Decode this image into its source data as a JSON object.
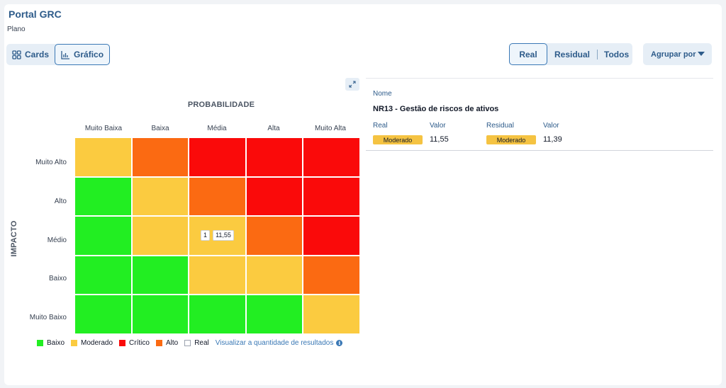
{
  "header": {
    "title": "Portal GRC",
    "subtitle": "Plano"
  },
  "view_toggle": {
    "cards": "Cards",
    "grafico": "Gráfico",
    "active": "grafico"
  },
  "mode_toggle": {
    "real": "Real",
    "residual": "Residual",
    "todos": "Todos",
    "active": "real"
  },
  "group_by": {
    "label": "Agrupar por"
  },
  "matrix": {
    "x_axis_title": "PROBABILIDADE",
    "y_axis_title": "IMPACTO",
    "columns": [
      "Muito Baixa",
      "Baixa",
      "Média",
      "Alta",
      "Muito Alta"
    ],
    "rows": [
      "Muito Alto",
      "Alto",
      "Médio",
      "Baixo",
      "Muito Baixo"
    ],
    "levels": {
      "baixo": "#22ee22",
      "moderado": "#fbcb40",
      "alto": "#fb6a12",
      "critico": "#fa0a0a"
    },
    "grid": [
      [
        "moderado",
        "alto",
        "critico",
        "critico",
        "critico"
      ],
      [
        "baixo",
        "moderado",
        "alto",
        "critico",
        "critico"
      ],
      [
        "baixo",
        "moderado",
        "moderado",
        "alto",
        "critico"
      ],
      [
        "baixo",
        "baixo",
        "moderado",
        "moderado",
        "alto"
      ],
      [
        "baixo",
        "baixo",
        "baixo",
        "baixo",
        "moderado"
      ]
    ],
    "marker": {
      "count": "1",
      "value": "11,55"
    }
  },
  "legend": {
    "baixo": "Baixo",
    "moderado": "Moderado",
    "critico": "Crítico",
    "alto": "Alto",
    "real": "Real",
    "link": "Visualizar a quantidade de resultados",
    "info_icon": "info-icon"
  },
  "detail": {
    "name_label": "Nome",
    "name": "NR13 - Gestão de riscos de ativos",
    "real_label": "Real",
    "real_valor_label": "Valor",
    "real_level": "Moderado",
    "real_value": "11,55",
    "residual_label": "Residual",
    "residual_valor_label": "Valor",
    "residual_level": "Moderado",
    "residual_value": "11,39"
  }
}
